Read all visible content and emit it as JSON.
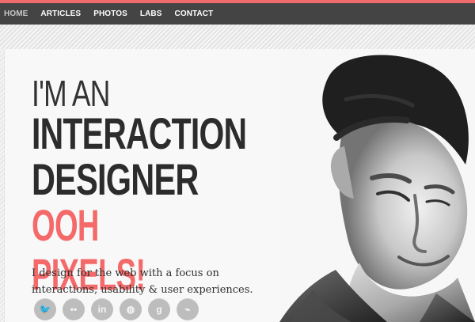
{
  "nav": {
    "items": [
      {
        "label": "HOME",
        "active": true
      },
      {
        "label": "ARTICLES",
        "active": false
      },
      {
        "label": "PHOTOS",
        "active": false
      },
      {
        "label": "LABS",
        "active": false
      },
      {
        "label": "CONTACT",
        "active": false
      }
    ]
  },
  "hero": {
    "line1": "I'M AN",
    "line2": "INTERACTION",
    "line3": "DESIGNER",
    "line4": "OOH PIXELS!",
    "tagline": "I design for the web with a focus on interactions, usability & user experiences."
  },
  "social": [
    {
      "name": "twitter",
      "glyph": "🐦"
    },
    {
      "name": "flickr",
      "glyph": "••"
    },
    {
      "name": "linkedin",
      "glyph": "in"
    },
    {
      "name": "dribbble",
      "glyph": "◍"
    },
    {
      "name": "google",
      "glyph": "g"
    },
    {
      "name": "rss",
      "glyph": "⌁"
    }
  ],
  "colors": {
    "accent": "#f06b6b",
    "nav_bg": "#444444",
    "headline": "#2f2f2f",
    "highlight": "#f46a6a",
    "icon_bg": "#bdbdbd"
  }
}
